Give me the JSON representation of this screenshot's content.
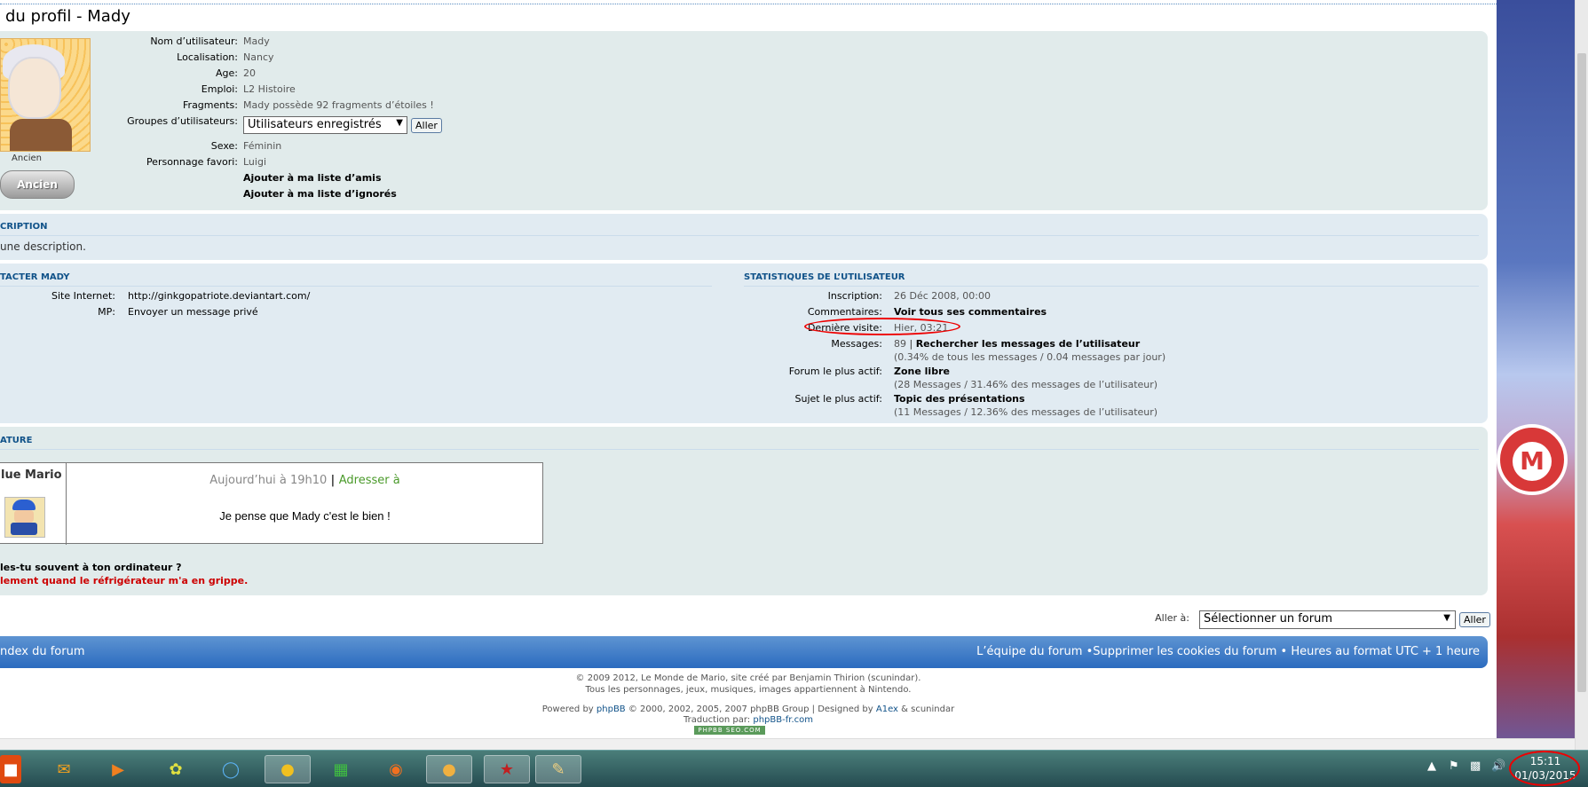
{
  "page": {
    "title": "du profil - Mady"
  },
  "profile": {
    "rank_label": "Ancien",
    "rank_badge": "Ancien",
    "fields": [
      {
        "label": "Nom d’utilisateur:",
        "value": "Mady"
      },
      {
        "label": "Localisation:",
        "value": "Nancy"
      },
      {
        "label": "Age:",
        "value": "20"
      },
      {
        "label": "Emploi:",
        "value": "L2 Histoire"
      },
      {
        "label": "Fragments:",
        "value": "Mady possède 92 fragments d’étoiles !"
      }
    ],
    "groups_label": "Groupes d’utilisateurs:",
    "groups_selected": "Utilisateurs enregistrés",
    "groups_go": "Aller",
    "sexe_label": "Sexe:",
    "sexe_value": "Féminin",
    "fav_label": "Personnage favori:",
    "fav_value": "Luigi",
    "add_friend": "Ajouter à ma liste d’amis",
    "add_ignored": "Ajouter à ma liste d’ignorés"
  },
  "description": {
    "heading": "CRIPTION",
    "text": "une description."
  },
  "contact": {
    "heading": "TACTER MADY",
    "website_label": "Site Internet:",
    "website_value": "http://ginkgopatriote.deviantart.com/",
    "pm_label": "MP:",
    "pm_value": "Envoyer un message privé"
  },
  "stats": {
    "heading": "STATISTIQUES DE L’UTILISATEUR",
    "inscription_label": "Inscription:",
    "inscription_value": "26 Déc 2008, 00:00",
    "comments_label": "Commentaires:",
    "comments_value": "Voir tous ses commentaires",
    "last_visit_label": "Dernière visite:",
    "last_visit_value": "Hier, 03:21",
    "messages_label": "Messages:",
    "messages_count": "89",
    "messages_search": "Rechercher les messages de l’utilisateur",
    "messages_detail": "(0.34% de tous les messages / 0.04 messages par jour)",
    "active_forum_label": "Forum le plus actif:",
    "active_forum_value": "Zone libre",
    "active_forum_detail": "(28 Messages / 31.46% des messages de l’utilisateur)",
    "active_topic_label": "Sujet le plus actif:",
    "active_topic_value": "Topic des présentations",
    "active_topic_detail": "(11 Messages / 12.36% des messages de l’utilisateur)"
  },
  "signature": {
    "heading": "ATURE",
    "post_author": "lue Mario",
    "post_date": "Aujourd’hui à 19h10",
    "post_reply": "Adresser à",
    "post_text": "Je pense que Mady c'est le bien !",
    "line1": "les-tu souvent à ton ordinateur ?",
    "line2": "lement quand le réfrigérateur m'a en grippe."
  },
  "jump": {
    "label": "Aller à:",
    "selected": "Sélectionner un forum",
    "go": "Aller"
  },
  "navbar": {
    "index": "ndex du forum",
    "team": "L’équipe du forum",
    "cookies": "Supprimer les cookies du forum",
    "timezone": "Heures au format UTC + 1 heure"
  },
  "footer": {
    "line1": "© 2009 2012, Le Monde de Mario, site créé par Benjamin Thirion (scunindar).",
    "line2": "Tous les personnages, jeux, musiques, images appartiennent à Nintendo.",
    "powered_prefix": "Powered by",
    "powered_link": "phpBB",
    "powered_suffix": "© 2000, 2002, 2005, 2007 phpBB Group | Designed by",
    "designer": "A1ex",
    "designer_suffix": "& scunindar",
    "translation_prefix": "Traduction par:",
    "translation_link": "phpBB-fr.com",
    "badge": "PHPBB SEO.COM"
  },
  "taskbar": {
    "time": "15:11",
    "date": "01/03/2015",
    "icons": [
      "office-icon",
      "outlook-icon",
      "media-player-icon",
      "photos-icon",
      "speedtest-icon",
      "chrome-icon",
      "store-icon",
      "firefox-icon",
      "chrome-canary-icon",
      "app-red-icon",
      "paint-icon"
    ]
  },
  "colors": {
    "panel_grey": "#e1ebeb",
    "panel_blue": "#e1ebf2",
    "heading_blue": "#105289",
    "navbar_blue": "#2b6bbf",
    "highlight_red": "#e00000"
  }
}
